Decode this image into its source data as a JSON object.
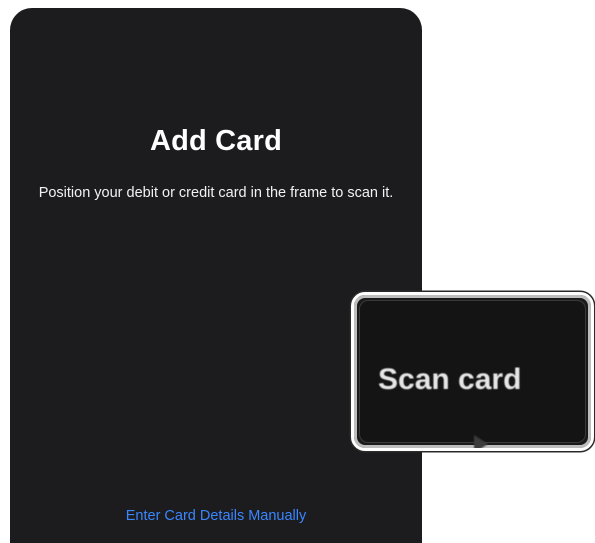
{
  "sheet": {
    "title": "Add Card",
    "instructions": "Position your debit or credit card in the frame to scan it.",
    "manual_entry_link": "Enter Card Details Manually"
  },
  "zoom_callout": {
    "label": "Scan card",
    "icon": "play-icon"
  },
  "colors": {
    "sheet_background": "#1c1c1e",
    "link": "#3a86ff",
    "page_background": "#ffffff"
  }
}
